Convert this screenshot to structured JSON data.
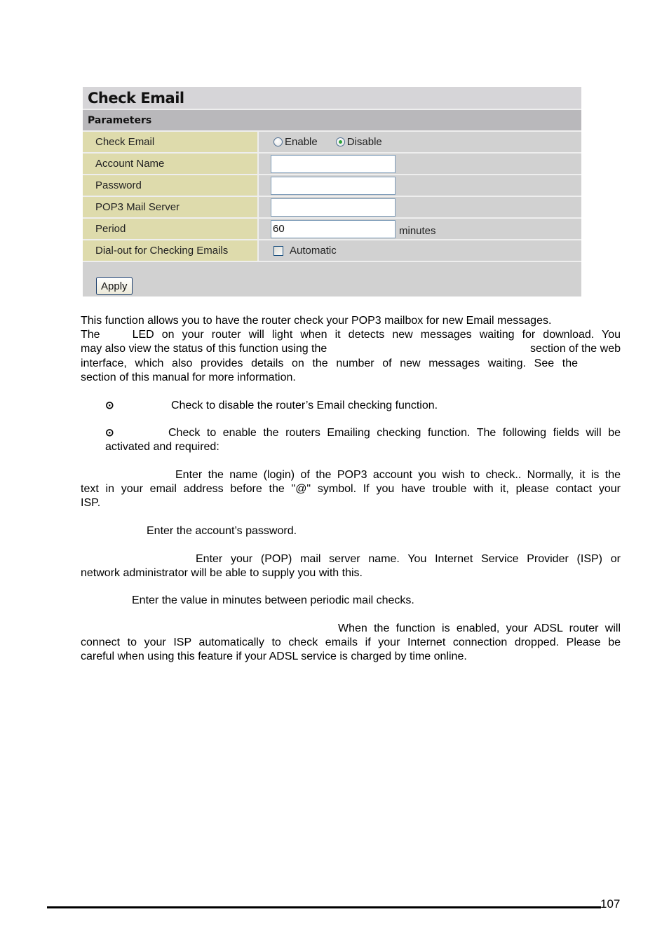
{
  "panel": {
    "title": "Check Email",
    "section": "Parameters",
    "rows": {
      "check_email": {
        "label": "Check Email",
        "options": [
          {
            "label": "Enable",
            "checked": false
          },
          {
            "label": "Disable",
            "checked": true
          }
        ]
      },
      "account_name": {
        "label": "Account Name",
        "value": ""
      },
      "password": {
        "label": "Password",
        "value": ""
      },
      "pop3_server": {
        "label": "POP3 Mail Server",
        "value": ""
      },
      "period": {
        "label": "Period",
        "value": "60",
        "unit": "minutes"
      },
      "dial_out": {
        "label": "Dial-out for Checking Emails",
        "checkbox_label": "Automatic",
        "checked": false
      }
    },
    "apply_label": "Apply",
    "colors": {
      "title_bg": "#d6d5d8",
      "section_bg": "#b9b8bb",
      "label_bg": "#dedbac",
      "value_bg": "#d1d1d1"
    }
  },
  "doc": {
    "intro": {
      "line1": "This function allows you to have the router check your POP3 mailbox for new Email messages.",
      "line2a": "The",
      "line2b": "LED on your router will light when it detects new messages waiting for download. You",
      "line3a": "may also view the status of this function using the",
      "line3b": "section of the web",
      "line4": "interface, which also provides details on the number of new messages waiting. See the",
      "line5": "section of this manual for more information."
    },
    "bullets": {
      "glyph": "⊙",
      "disable_text": "Check to disable the router’s Email checking function.",
      "enable_line1": "Check to enable the routers Emailing checking function. The following fields will be",
      "enable_line2": "activated and required:"
    },
    "account_name": {
      "line1": "Enter the name (login) of the POP3 account you wish to check.. Normally, it is the",
      "line2": "text in your email address before the \"@\" symbol. If you have trouble with it, please contact your",
      "line3": "ISP."
    },
    "password": "Enter the account’s password.",
    "server": {
      "line1": "Enter your (POP) mail server name. You Internet Service Provider (ISP) or",
      "line2": "network administrator will be able to supply you with this."
    },
    "period": "Enter the value in minutes between periodic mail checks.",
    "dialout": {
      "line1": "When the function is enabled, your ADSL router will",
      "line2": "connect to your ISP automatically to check emails if your Internet connection dropped. Please be",
      "line3": "careful when using this feature if your ADSL service is charged by time online."
    }
  },
  "footer": {
    "page_number": "107"
  }
}
